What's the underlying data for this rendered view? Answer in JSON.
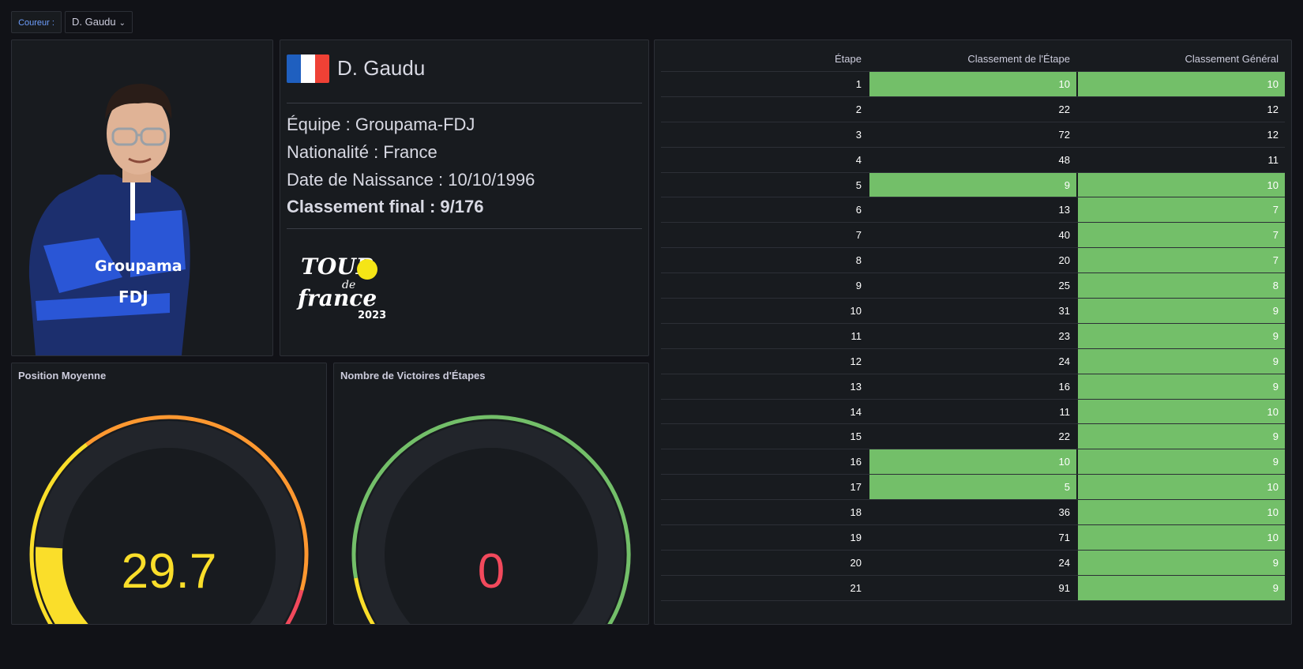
{
  "variable": {
    "label": "Coureur :",
    "value": "D. Gaudu",
    "chevron_icon": "chevron-down-icon"
  },
  "rider": {
    "name": "D. Gaudu",
    "flag_colors": [
      "#1f5fbf",
      "#ffffff",
      "#ef4135"
    ],
    "team_line": "Équipe : Groupama-FDJ",
    "nationality_line": "Nationalité : France",
    "birth_line": "Date de Naissance : 10/10/1996",
    "final_rank_line": "Classement final : 9/176"
  },
  "logo": {
    "line1": "TOUR",
    "line2": "de",
    "line3": "france",
    "year": "2023"
  },
  "jersey_text": {
    "sponsor1": "Groupama",
    "sponsor2": "FDJ"
  },
  "gauges": [
    {
      "title": "Position Moyenne",
      "value": "29.7",
      "value_color": "#fade2a",
      "fill_fraction": 0.17
    },
    {
      "title": "Nombre de Victoires d'Étapes",
      "value": "0",
      "value_color": "#f2495c",
      "fill_fraction": 0.0
    }
  ],
  "table": {
    "headers": [
      "Étape",
      "Classement de l'Étape",
      "Classement Général"
    ],
    "highlight_color": "#73bf69",
    "rows": [
      {
        "etape": "1",
        "stage": "10",
        "general": "10",
        "hs": true,
        "hg": true
      },
      {
        "etape": "2",
        "stage": "22",
        "general": "12",
        "hs": false,
        "hg": false
      },
      {
        "etape": "3",
        "stage": "72",
        "general": "12",
        "hs": false,
        "hg": false
      },
      {
        "etape": "4",
        "stage": "48",
        "general": "11",
        "hs": false,
        "hg": false
      },
      {
        "etape": "5",
        "stage": "9",
        "general": "10",
        "hs": true,
        "hg": true
      },
      {
        "etape": "6",
        "stage": "13",
        "general": "7",
        "hs": false,
        "hg": true
      },
      {
        "etape": "7",
        "stage": "40",
        "general": "7",
        "hs": false,
        "hg": true
      },
      {
        "etape": "8",
        "stage": "20",
        "general": "7",
        "hs": false,
        "hg": true
      },
      {
        "etape": "9",
        "stage": "25",
        "general": "8",
        "hs": false,
        "hg": true
      },
      {
        "etape": "10",
        "stage": "31",
        "general": "9",
        "hs": false,
        "hg": true
      },
      {
        "etape": "11",
        "stage": "23",
        "general": "9",
        "hs": false,
        "hg": true
      },
      {
        "etape": "12",
        "stage": "24",
        "general": "9",
        "hs": false,
        "hg": true
      },
      {
        "etape": "13",
        "stage": "16",
        "general": "9",
        "hs": false,
        "hg": true
      },
      {
        "etape": "14",
        "stage": "11",
        "general": "10",
        "hs": false,
        "hg": true
      },
      {
        "etape": "15",
        "stage": "22",
        "general": "9",
        "hs": false,
        "hg": true
      },
      {
        "etape": "16",
        "stage": "10",
        "general": "9",
        "hs": true,
        "hg": true
      },
      {
        "etape": "17",
        "stage": "5",
        "general": "10",
        "hs": true,
        "hg": true
      },
      {
        "etape": "18",
        "stage": "36",
        "general": "10",
        "hs": false,
        "hg": true
      },
      {
        "etape": "19",
        "stage": "71",
        "general": "10",
        "hs": false,
        "hg": true
      },
      {
        "etape": "20",
        "stage": "24",
        "general": "9",
        "hs": false,
        "hg": true
      },
      {
        "etape": "21",
        "stage": "91",
        "general": "9",
        "hs": false,
        "hg": true
      }
    ]
  }
}
